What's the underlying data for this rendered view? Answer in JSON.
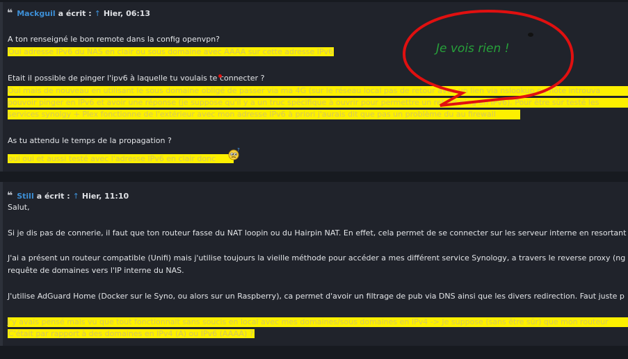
{
  "quote1": {
    "author": "Mackguil",
    "wrote": "a écrit :",
    "arrow": "↑",
    "time": "Hier, 06:13",
    "lines": [
      "A ton renseigné le bon remote dans la config openvpn?",
      "Oui adresse IPv6 du NAS en clair ou sous domaine avec AAAA sur cette adresse IPv6",
      "Etait il possible de pinger l'ipv6 à laquelle tu voulais te connecter ?",
      "Oui mais de nouveau en utilisant le sous domaine obligé de passer via ma 4G (sur le réseau local pas de retour avec un lien via nslookup ou hôte introuva",
      "pouvoir pinger en IPv6 et avoir une réponse (je suppose qu'il y a un truc spécifique à ouvrir pour permettre un retour ping en IPv6). Pour être sûr testé les",
      "services synolgy + Plex fonctionne de l'extérieur avec mon adresse IPv6 à priori j'aurais dit que pas un problème du au firewall",
      "As tu attendu le temps de la propagation ?",
      "oui oui et aussi testé avec l'adresse IPv6 en clair donc"
    ]
  },
  "quote2": {
    "author": "Still",
    "wrote": "a écrit :",
    "arrow": "↑",
    "time": "Hier, 11:10",
    "lines": [
      "Salut,",
      "Si je dis pas de connerie, il faut que ton routeur fasse du NAT loopin ou du Hairpin NAT. En effet, cela permet de se connecter sur les serveur interne en resortant",
      "J'ai a présent un routeur compatible (Unifi) mais j'utilise toujours la vieille méthode pour accéder a mes différent service Synology, a travers le reverse proxy (ng",
      "requête de domaines vers l'IP interne du NAS.",
      "J'utilise AdGuard Home (Docker sur le Syno, ou alors sur un Raspberry), ca permet d'avoir un filtrage de pub via DNS ainsi que les divers redirection. Faut juste p",
      "J'y avais pensé mais vu que tout fonctionnait sans soucis en local avec mes domaines/sous domaines en IPv4 -> Je suppose (sans être sûr) que mon routeur",
      "C'était par rapport à des domaines en IPv4 (A) ou IPv6 (AAAA) ?"
    ]
  },
  "annotation": {
    "text": "Je vois rien !",
    "color": "#27a13a",
    "bubble_color": "#e01010"
  },
  "colors": {
    "highlight": "#fdf000",
    "author_link": "#3d8fd6",
    "background": "#171a20"
  },
  "icons": [
    "quote-icon",
    "up-arrow-icon",
    "confused-emoji-icon"
  ]
}
